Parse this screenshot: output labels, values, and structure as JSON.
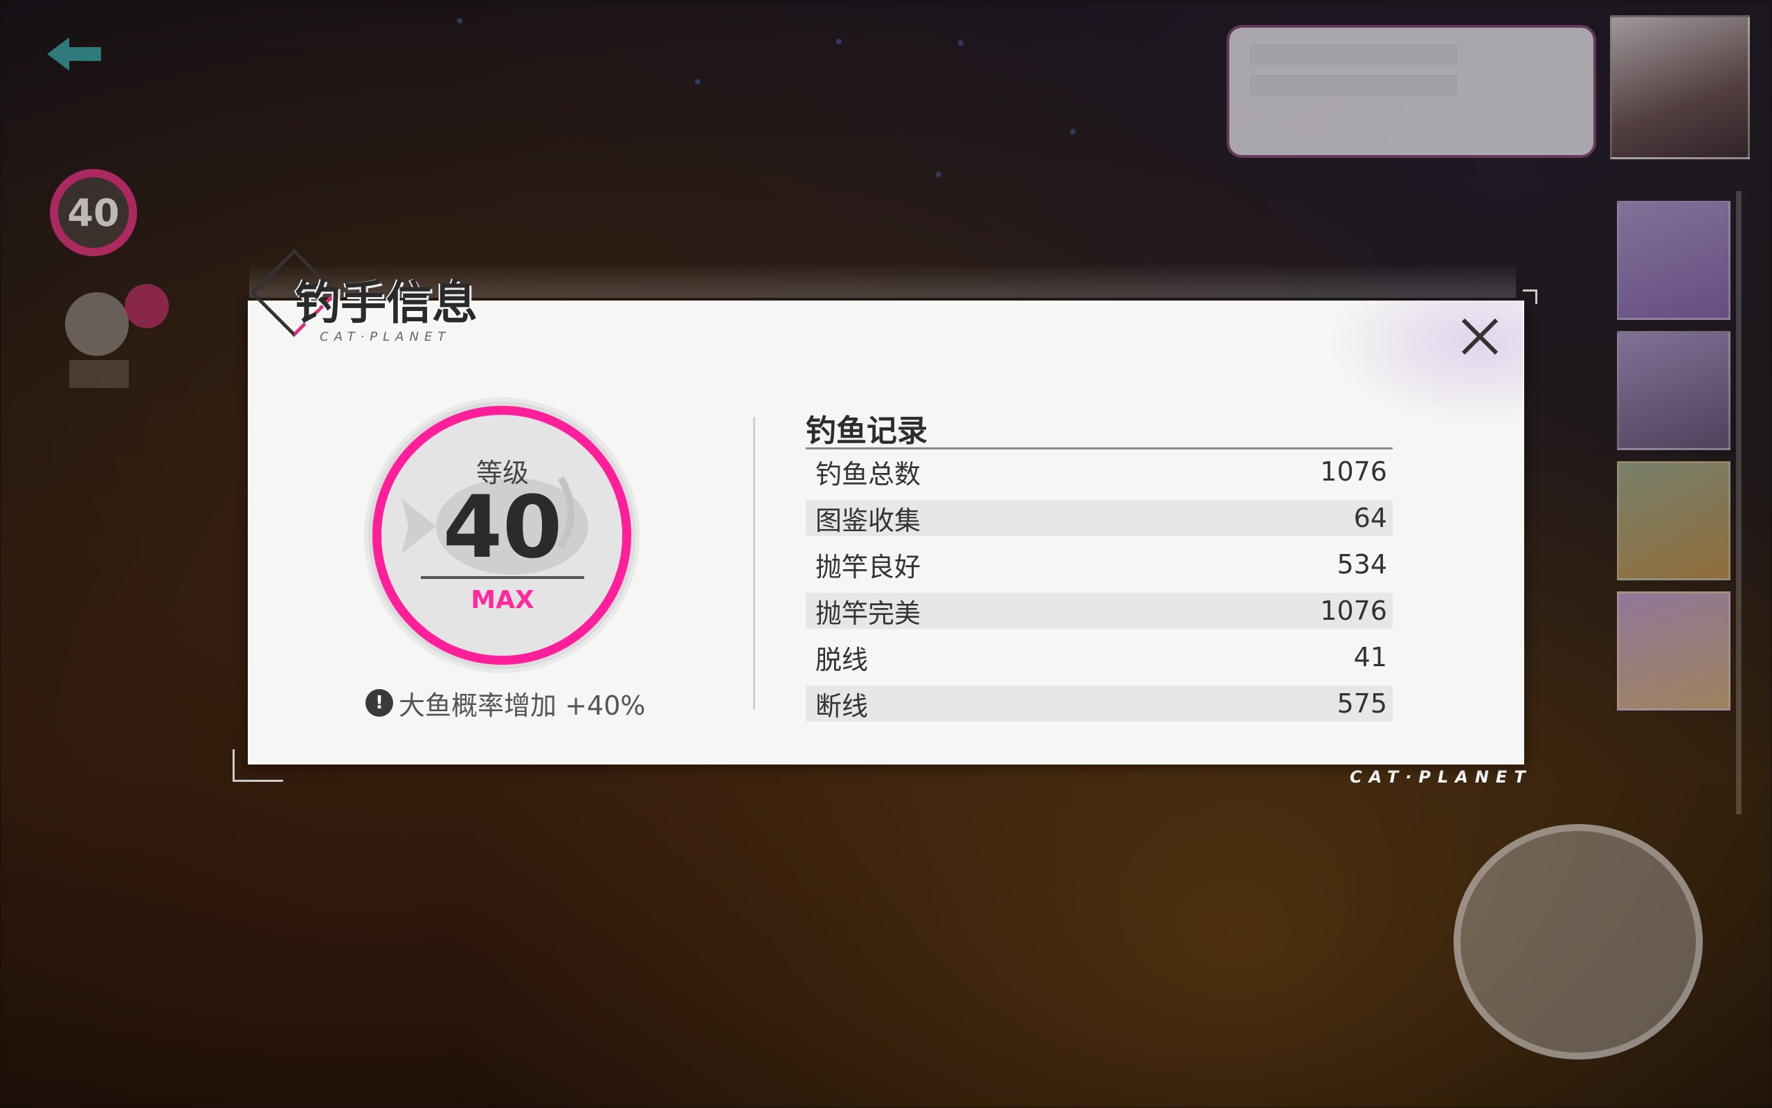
{
  "dialog": {
    "title": "钓手信息",
    "subtitle": "CAT·PLANET",
    "close_icon": "close-icon"
  },
  "level": {
    "label": "等级",
    "value": "40",
    "max_label": "MAX",
    "bonus_text": "大鱼概率增加 +40%",
    "bonus_icon": "!"
  },
  "records": {
    "title": "钓鱼记录",
    "rows": [
      {
        "label": "钓鱼总数",
        "value": "1076"
      },
      {
        "label": "图鉴收集",
        "value": "64"
      },
      {
        "label": "抛竿良好",
        "value": "534"
      },
      {
        "label": "抛竿完美",
        "value": "1076"
      },
      {
        "label": "脱线",
        "value": "41"
      },
      {
        "label": "断线",
        "value": "575"
      }
    ]
  },
  "hud": {
    "level": "40",
    "brand_mark": "CAT·PLANET"
  },
  "colors": {
    "accent_pink": "#ff1f9a",
    "dialog_bg": "#f6f6f4",
    "row_alt_bg": "#e7e7e7"
  }
}
